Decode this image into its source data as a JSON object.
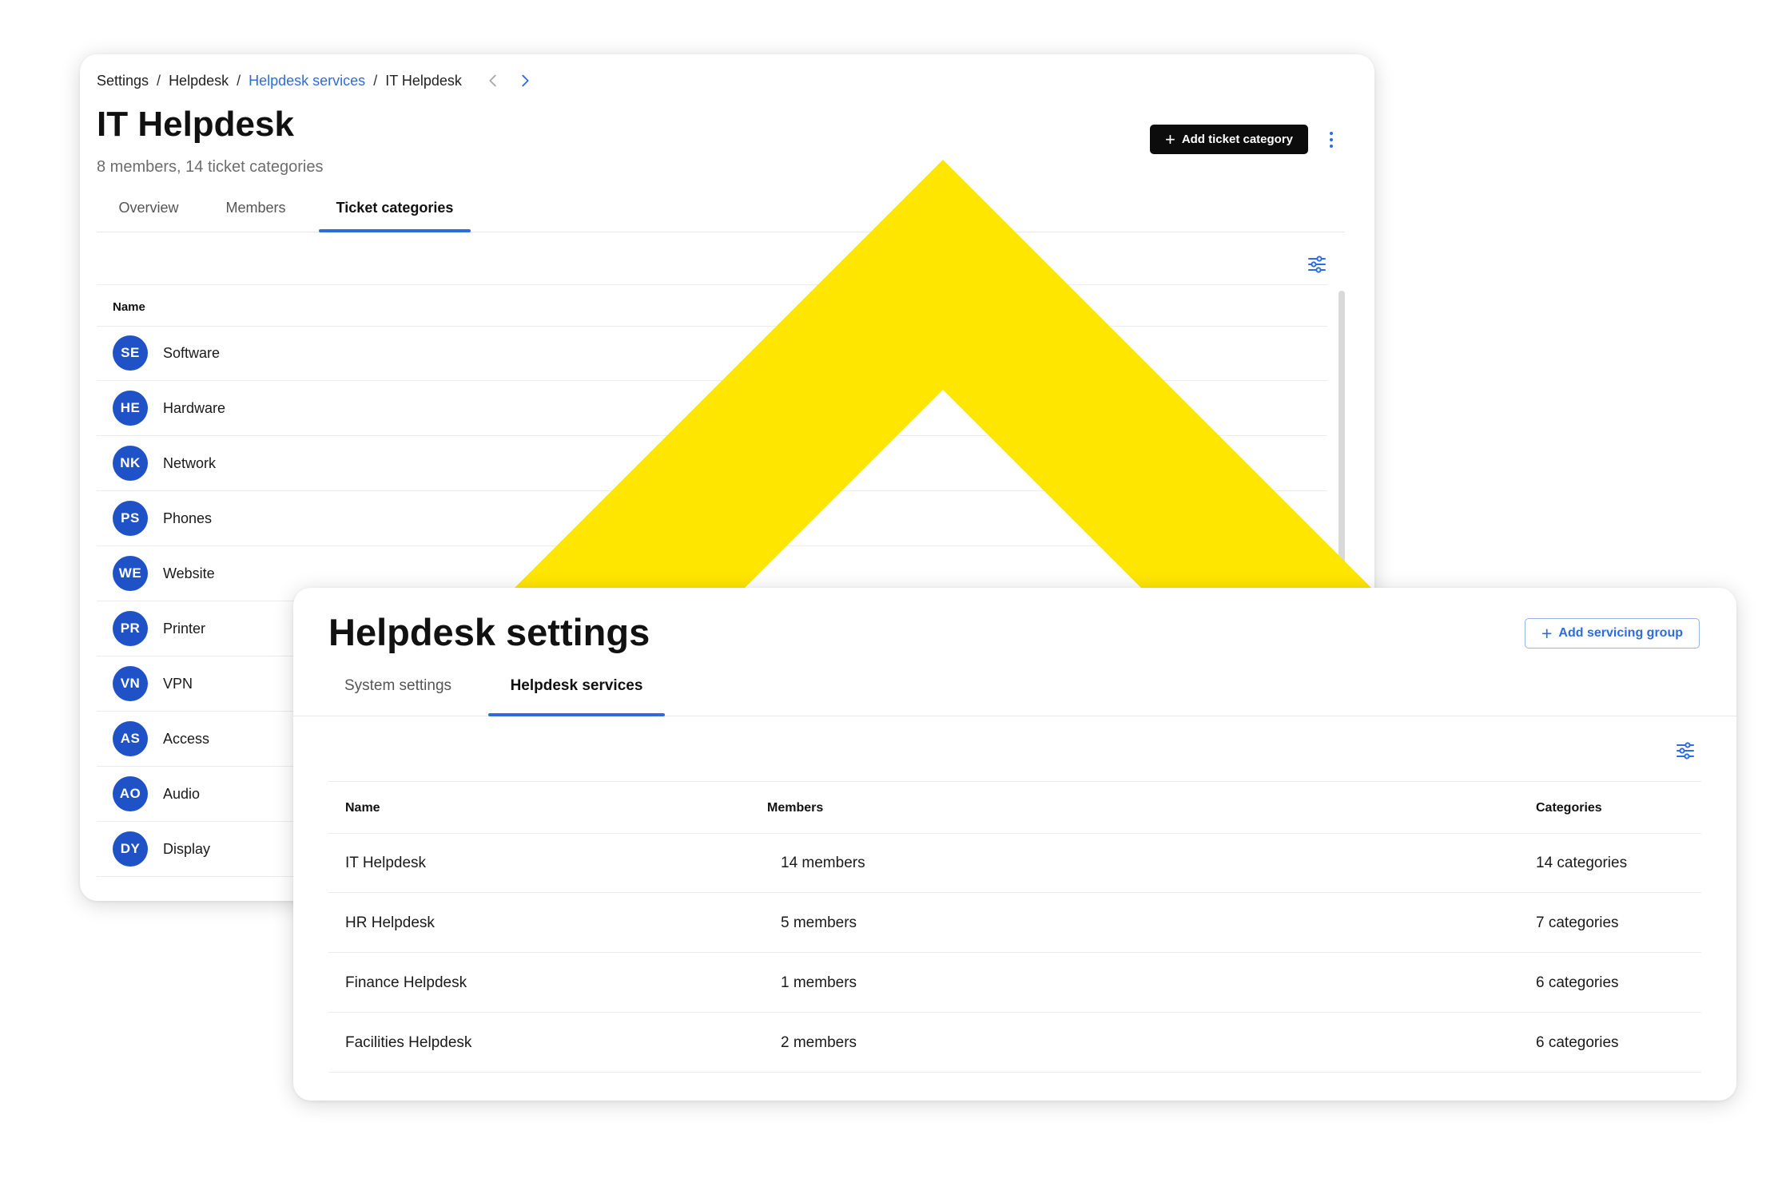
{
  "it_helpdesk": {
    "breadcrumb": [
      {
        "label": "Settings",
        "link": false
      },
      {
        "label": "Helpdesk",
        "link": false
      },
      {
        "label": "Helpdesk services",
        "link": true
      },
      {
        "label": "IT Helpdesk",
        "link": false
      }
    ],
    "breadcrumb_separator": "/",
    "title": "IT Helpdesk",
    "subtitle": "8 members, 14 ticket categories",
    "add_button_label": "Add ticket category",
    "tabs": [
      {
        "label": "Overview",
        "active": false
      },
      {
        "label": "Members",
        "active": false
      },
      {
        "label": "Ticket categories",
        "active": true
      }
    ],
    "table_header": "Name",
    "categories": [
      {
        "initials": "SE",
        "name": "Software"
      },
      {
        "initials": "HE",
        "name": "Hardware"
      },
      {
        "initials": "NK",
        "name": "Network"
      },
      {
        "initials": "PS",
        "name": "Phones"
      },
      {
        "initials": "WE",
        "name": "Website"
      },
      {
        "initials": "PR",
        "name": "Printer"
      },
      {
        "initials": "VN",
        "name": "VPN"
      },
      {
        "initials": "AS",
        "name": "Access"
      },
      {
        "initials": "AO",
        "name": "Audio"
      },
      {
        "initials": "DY",
        "name": "Display"
      }
    ]
  },
  "helpdesk_settings": {
    "title": "Helpdesk settings",
    "add_button_label": "Add servicing group",
    "tabs": [
      {
        "label": "System settings",
        "active": false
      },
      {
        "label": "Helpdesk services",
        "active": true
      }
    ],
    "columns": {
      "name": "Name",
      "members": "Members",
      "categories": "Categories"
    },
    "rows": [
      {
        "name": "IT Helpdesk",
        "members": "14 members",
        "categories": "14 categories"
      },
      {
        "name": "HR Helpdesk",
        "members": "5 members",
        "categories": "7 categories"
      },
      {
        "name": "Finance Helpdesk",
        "members": "1 members",
        "categories": "6 categories"
      },
      {
        "name": "Facilities Helpdesk",
        "members": "2 members",
        "categories": "6 categories"
      }
    ]
  },
  "icons": {
    "back_arrow": "chevron-left-icon",
    "forward_arrow": "chevron-right-icon",
    "filter": "filter-sliders-icon",
    "more": "more-vertical-icon",
    "add": "plus-icon"
  },
  "colors": {
    "accent": "#2f6be0",
    "avatar_bg": "#1f52c7",
    "primary_button": "#0c0c0c",
    "decorative_chevron": "#ffe600"
  }
}
